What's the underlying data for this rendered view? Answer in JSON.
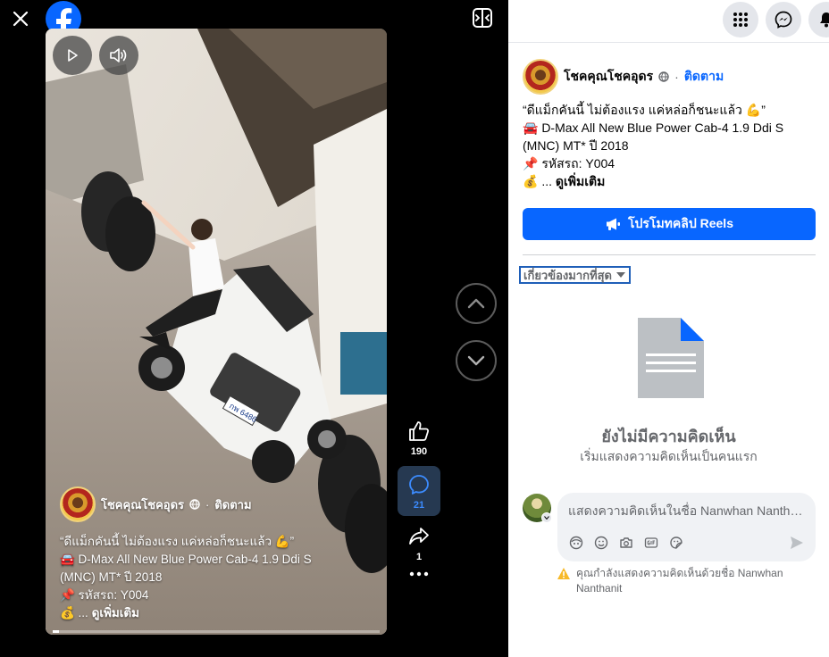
{
  "viewer": {
    "video": {
      "author": "โชคคุณโชคอุดร",
      "dot": "·",
      "follow": "ติดตาม",
      "caption_lines": [
        "“ดีแม็กคันนี้ ไม่ต้องแรง แค่หล่อก็ชนะแล้ว 💪”",
        "🚘 D-Max All New Blue Power Cab-4 1.9 Ddi S",
        "(MNC) MT* ปี 2018",
        "📌 รหัสรถ: Y004"
      ],
      "more_prefix": "💰 ... ",
      "more_label": "ดูเพิ่มเติม",
      "plate_text": "กพ 6486",
      "progress": 0.02
    },
    "actions": {
      "likes": "190",
      "comments": "21",
      "shares": "1"
    }
  },
  "panel": {
    "post": {
      "author": "โชคคุณโชคอุดร",
      "dot": "·",
      "follow": "ติดตาม",
      "lines": [
        "“ดีแม็กคันนี้ ไม่ต้องแรง แค่หล่อก็ชนะแล้ว 💪”",
        "🚘 D-Max All New Blue Power Cab-4 1.9 Ddi S (MNC) MT* ปี 2018",
        "📌 รหัสรถ: Y004"
      ],
      "more_prefix": "💰 ... ",
      "more_label": "ดูเพิ่มเติม"
    },
    "promote_label": "โปรโมทคลิป Reels",
    "sort_label": "เกี่ยวข้องมากที่สุด",
    "empty": {
      "title": "ยังไม่มีความคิดเห็น",
      "subtitle": "เริ่มแสดงความคิดเห็นเป็นคนแรก"
    },
    "comment": {
      "placeholder": "แสดงความคิดเห็นในชื่อ Nanwhan Nanthanit",
      "warning": "คุณกำลังแสดงความคิดเห็นด้วยชื่อ Nanwhan Nanthanit"
    }
  },
  "colors": {
    "accent": "#0866ff",
    "panel_bg": "#ffffff",
    "viewer_bg": "#000000"
  }
}
